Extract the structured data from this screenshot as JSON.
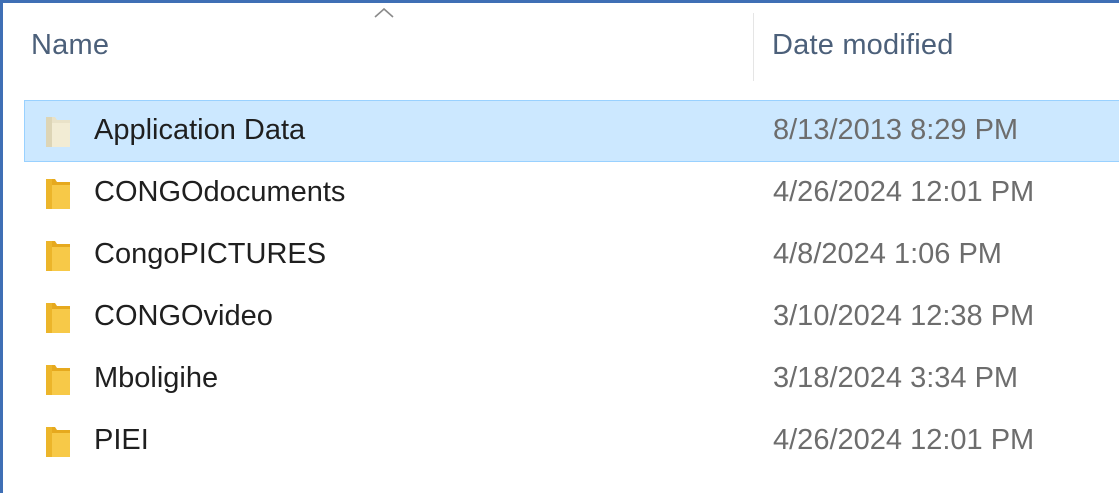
{
  "columns": {
    "name": "Name",
    "date_modified": "Date modified"
  },
  "sort": {
    "column": "name",
    "direction": "ascending"
  },
  "colors": {
    "selection_bg": "#cce8ff",
    "selection_border": "#99d1ff",
    "folder_yellow": "#f7c948",
    "frame_border": "#3f6fb5"
  },
  "rows": [
    {
      "name": "Application Data",
      "date": "8/13/2013 8:29 PM",
      "selected": true,
      "icon": "folder-icon-faded"
    },
    {
      "name": "CONGOdocuments",
      "date": "4/26/2024 12:01 PM",
      "selected": false,
      "icon": "folder-icon"
    },
    {
      "name": "CongoPICTURES",
      "date": "4/8/2024 1:06 PM",
      "selected": false,
      "icon": "folder-icon"
    },
    {
      "name": "CONGOvideo",
      "date": "3/10/2024 12:38 PM",
      "selected": false,
      "icon": "folder-icon"
    },
    {
      "name": "Mboligihe",
      "date": "3/18/2024 3:34 PM",
      "selected": false,
      "icon": "folder-icon"
    },
    {
      "name": "PIEI",
      "date": "4/26/2024 12:01 PM",
      "selected": false,
      "icon": "folder-icon"
    }
  ]
}
